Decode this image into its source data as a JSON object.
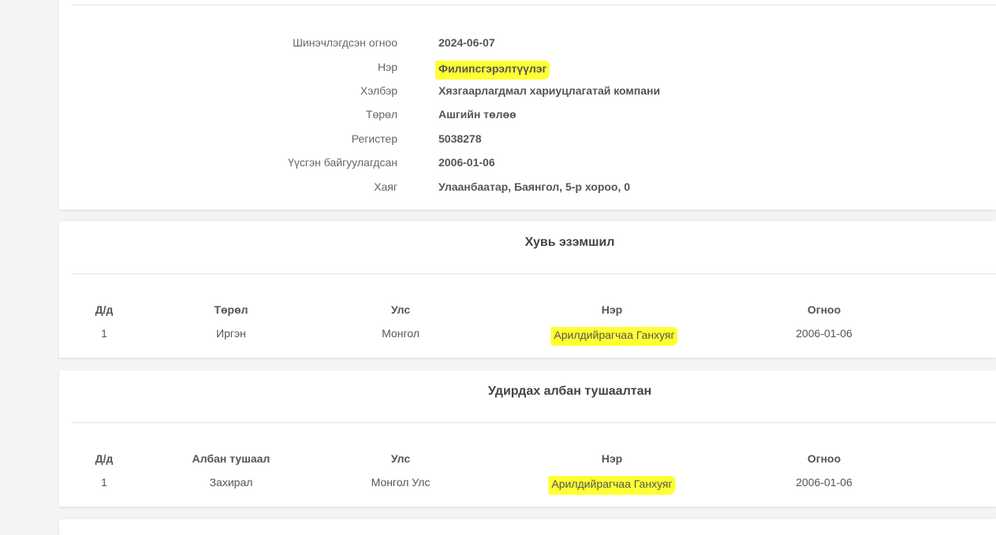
{
  "company_info": {
    "rows": [
      {
        "label": "Шинэчлэгдсэн огноо",
        "value": "2024-06-07"
      },
      {
        "label": "Нэр",
        "value": "Филипсгэрэлтүүлэг"
      },
      {
        "label": "Хэлбэр",
        "value": "Хязгаарлагдмал хариуцлагатай компани"
      },
      {
        "label": "Төрөл",
        "value": "Ашгийн төлөө"
      },
      {
        "label": "Регистер",
        "value": "5038278"
      },
      {
        "label": "Үүсгэн байгуулагдсан",
        "value": "2006-01-06"
      },
      {
        "label": "Хаяг",
        "value": "Улаанбаатар, Баянгол, 5-р хороо, 0"
      }
    ]
  },
  "ownership": {
    "title": "Хувь эзэмшил",
    "headers": [
      "Д/д",
      "Төрөл",
      "Улс",
      "Нэр",
      "Огноо"
    ],
    "rows": [
      [
        "1",
        "Иргэн",
        "Монгол",
        "Арилдийрагчаа Ганхуяг",
        "2006-01-06"
      ]
    ]
  },
  "officers": {
    "title": "Удирдах албан тушаалтан",
    "headers": [
      "Д/д",
      "Албан тушаал",
      "Улс",
      "Нэр",
      "Огноо"
    ],
    "rows": [
      [
        "1",
        "Захирал",
        "Монгол Улс",
        "Арилдийрагчаа Ганхуяг",
        "2006-01-06"
      ]
    ]
  },
  "colors": {
    "highlight": "#ffff33",
    "card": "#ffffff",
    "page": "#f4f4f4"
  }
}
